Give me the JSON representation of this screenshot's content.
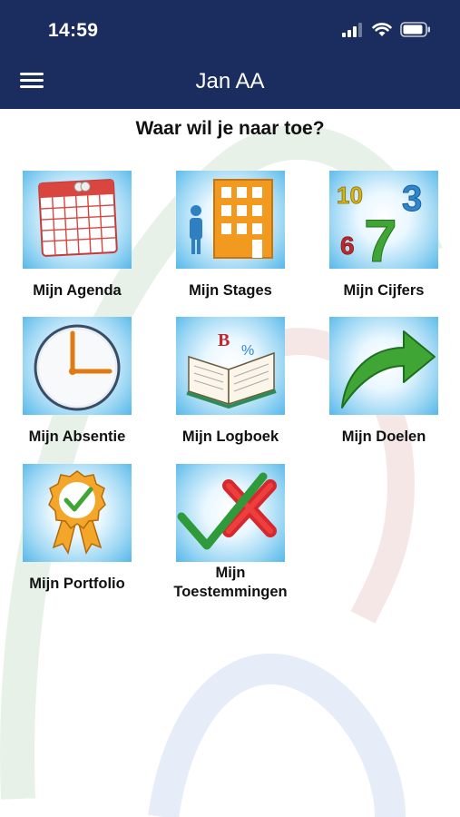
{
  "status_bar": {
    "time": "14:59"
  },
  "header": {
    "title": "Jan AA"
  },
  "prompt": "Waar wil je naar toe?",
  "tiles": [
    {
      "label": "Mijn Agenda",
      "icon": "calendar-icon"
    },
    {
      "label": "Mijn Stages",
      "icon": "building-icon"
    },
    {
      "label": "Mijn Cijfers",
      "icon": "numbers-icon"
    },
    {
      "label": "Mijn Absentie",
      "icon": "clock-icon"
    },
    {
      "label": "Mijn Logboek",
      "icon": "open-book-icon"
    },
    {
      "label": "Mijn Doelen",
      "icon": "arrow-icon"
    },
    {
      "label": "Mijn Portfolio",
      "icon": "award-ribbon-icon"
    },
    {
      "label": "Mijn Toestemmingen",
      "icon": "check-cross-icon"
    }
  ],
  "colors": {
    "header": "#1b2d5e",
    "tile_bg": "#56b8ea"
  }
}
